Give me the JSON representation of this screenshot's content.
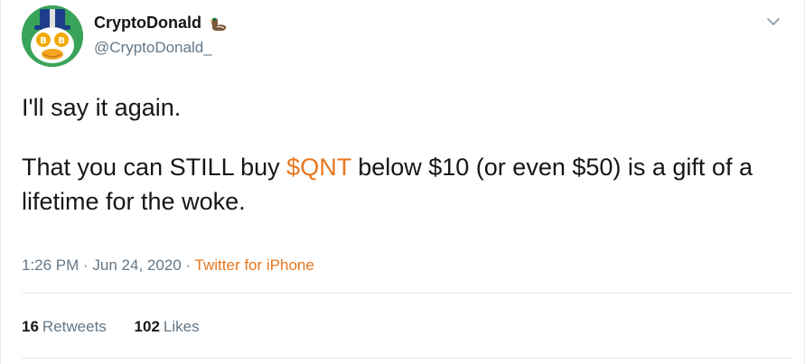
{
  "tweet": {
    "author": {
      "display_name": "CryptoDonald",
      "handle": "@CryptoDonald_",
      "name_badge_icon": "duck-emoji-icon",
      "avatar_icon": "duck-avatar"
    },
    "menu_icon": "chevron-down-icon",
    "text": {
      "line1": "I'll say it again.",
      "part_before_cashtag": "That you can STILL buy ",
      "cashtag": "$QNT",
      "part_after_cashtag": " below $10 (or even $50) is a gift of a lifetime for the woke."
    },
    "meta": {
      "time": "1:26 PM",
      "separator": " · ",
      "date": "Jun 24, 2020",
      "source": "Twitter for iPhone"
    },
    "stats": {
      "retweets_count": "16",
      "retweets_label": "Retweets",
      "likes_count": "102",
      "likes_label": "Likes"
    },
    "colors": {
      "link": "#e8761d",
      "text": "#14171a",
      "secondary": "#657786",
      "divider": "#e1e8ed"
    }
  }
}
